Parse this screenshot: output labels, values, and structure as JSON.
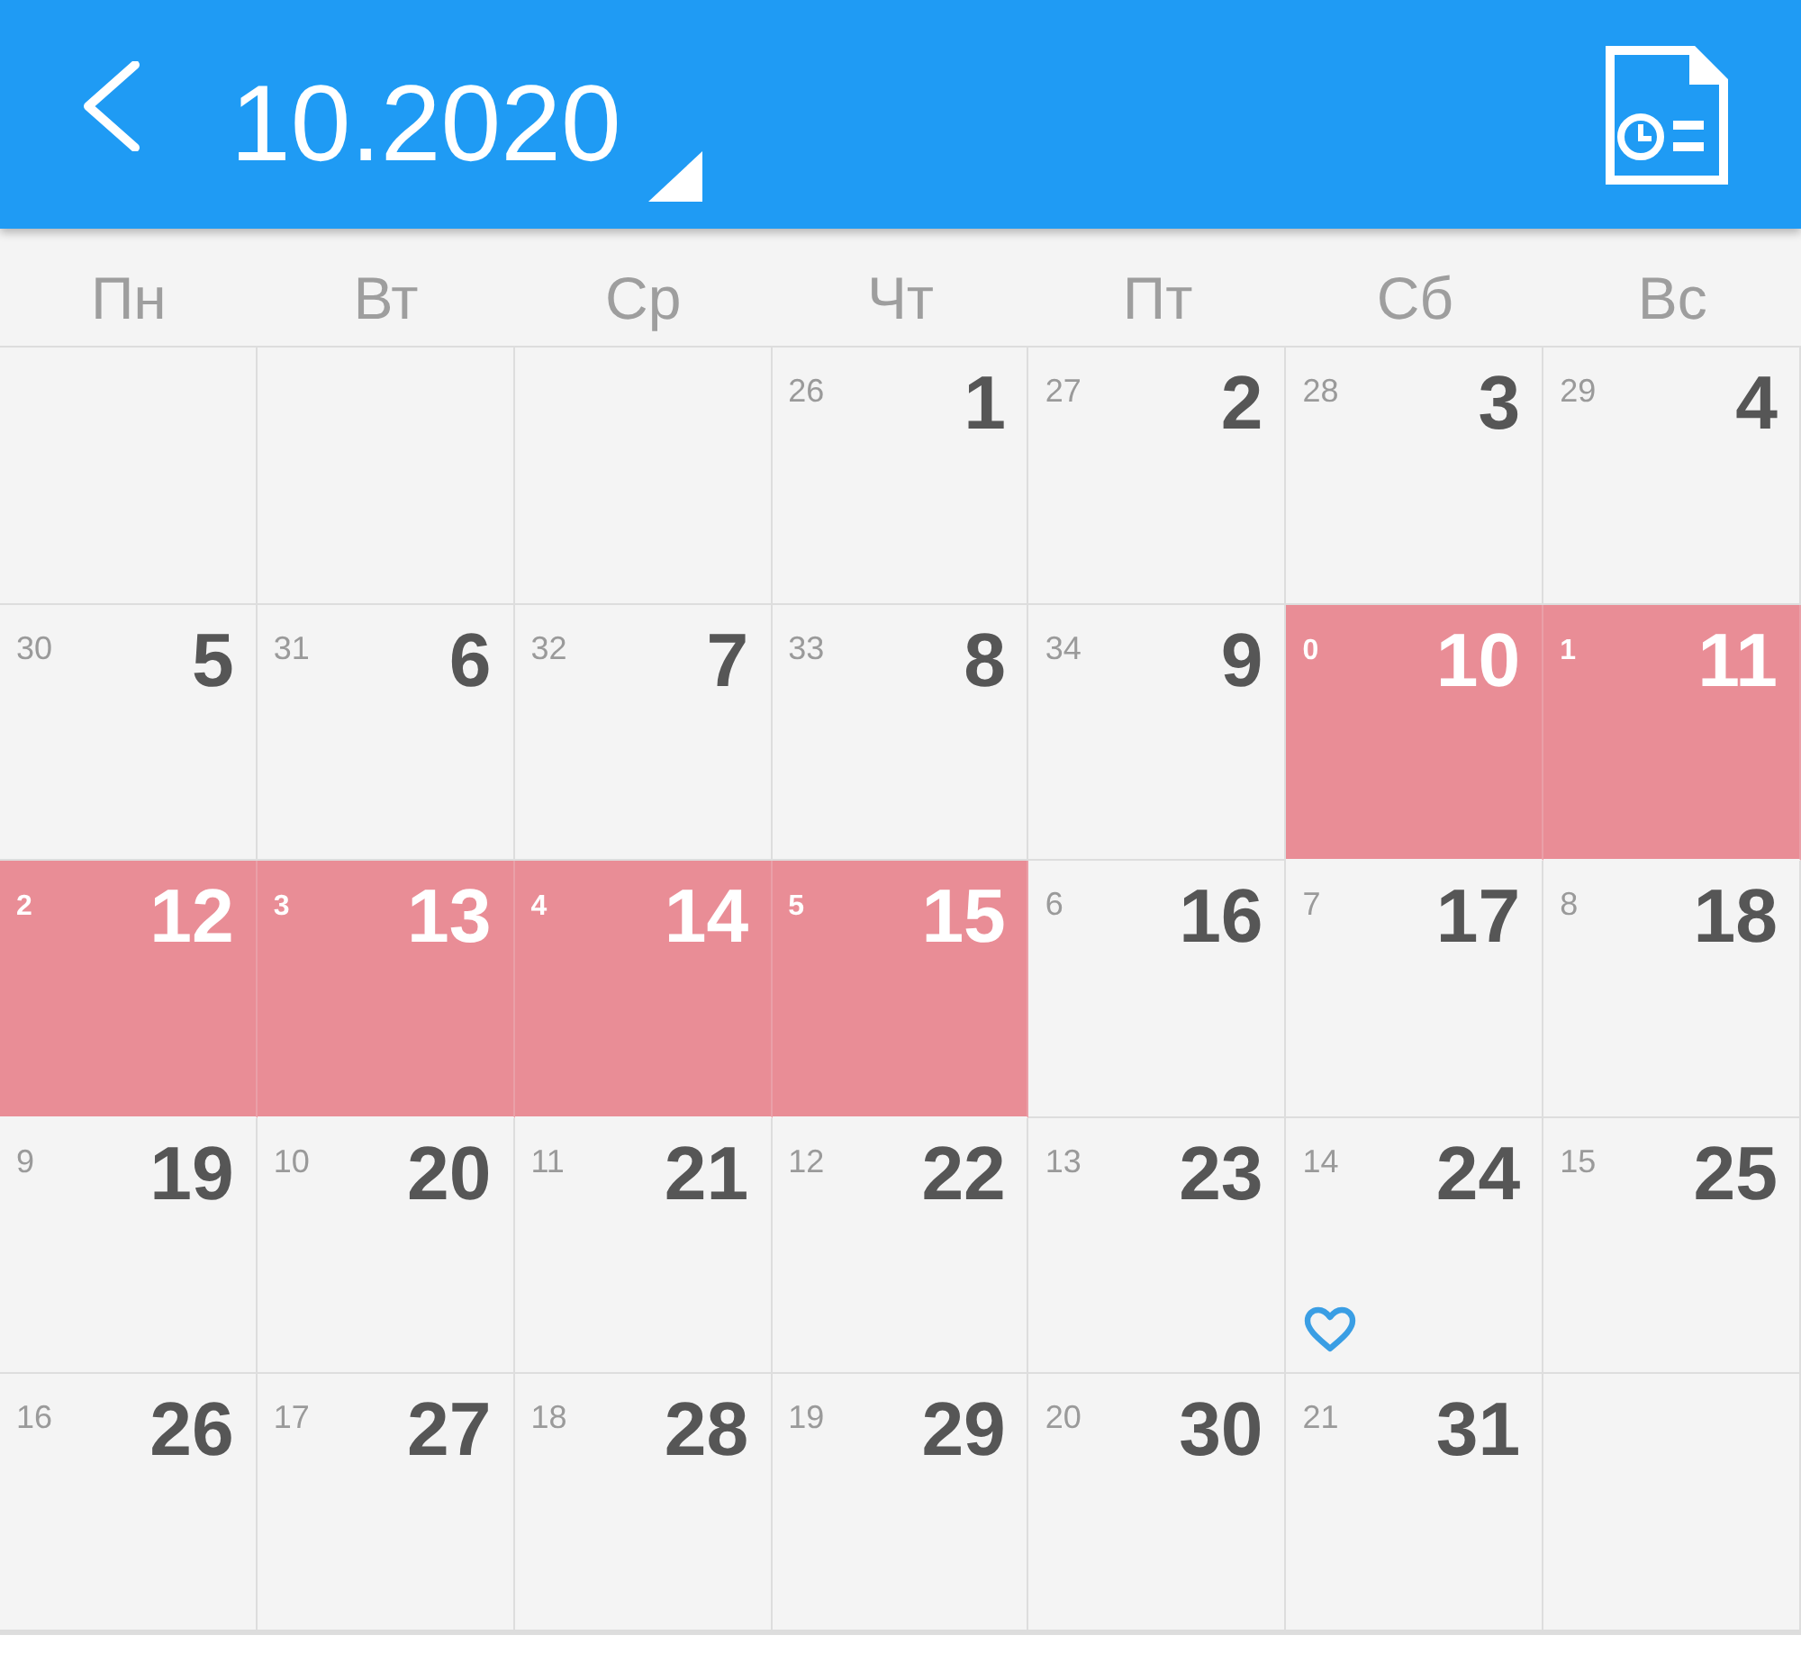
{
  "app_bar": {
    "title": "10.2020"
  },
  "weekdays": [
    "Пн",
    "Вт",
    "Ср",
    "Чт",
    "Пт",
    "Сб",
    "Вс"
  ],
  "weeks": [
    {
      "days": [
        {
          "kind": "empty"
        },
        {
          "kind": "empty"
        },
        {
          "kind": "empty"
        },
        {
          "kind": "day",
          "cycle_day": "26",
          "date": "1",
          "period": false,
          "heart": false
        },
        {
          "kind": "day",
          "cycle_day": "27",
          "date": "2",
          "period": false,
          "heart": false
        },
        {
          "kind": "day",
          "cycle_day": "28",
          "date": "3",
          "period": false,
          "heart": false
        },
        {
          "kind": "day",
          "cycle_day": "29",
          "date": "4",
          "period": false,
          "heart": false
        }
      ]
    },
    {
      "days": [
        {
          "kind": "day",
          "cycle_day": "30",
          "date": "5",
          "period": false,
          "heart": false
        },
        {
          "kind": "day",
          "cycle_day": "31",
          "date": "6",
          "period": false,
          "heart": false
        },
        {
          "kind": "day",
          "cycle_day": "32",
          "date": "7",
          "period": false,
          "heart": false
        },
        {
          "kind": "day",
          "cycle_day": "33",
          "date": "8",
          "period": false,
          "heart": false
        },
        {
          "kind": "day",
          "cycle_day": "34",
          "date": "9",
          "period": false,
          "heart": false
        },
        {
          "kind": "day",
          "cycle_day": "0",
          "date": "10",
          "period": true,
          "heart": false
        },
        {
          "kind": "day",
          "cycle_day": "1",
          "date": "11",
          "period": true,
          "heart": false
        }
      ]
    },
    {
      "days": [
        {
          "kind": "day",
          "cycle_day": "2",
          "date": "12",
          "period": true,
          "heart": false
        },
        {
          "kind": "day",
          "cycle_day": "3",
          "date": "13",
          "period": true,
          "heart": false
        },
        {
          "kind": "day",
          "cycle_day": "4",
          "date": "14",
          "period": true,
          "heart": false
        },
        {
          "kind": "day",
          "cycle_day": "5",
          "date": "15",
          "period": true,
          "heart": false
        },
        {
          "kind": "day",
          "cycle_day": "6",
          "date": "16",
          "period": false,
          "heart": false
        },
        {
          "kind": "day",
          "cycle_day": "7",
          "date": "17",
          "period": false,
          "heart": false
        },
        {
          "kind": "day",
          "cycle_day": "8",
          "date": "18",
          "period": false,
          "heart": false
        }
      ]
    },
    {
      "days": [
        {
          "kind": "day",
          "cycle_day": "9",
          "date": "19",
          "period": false,
          "heart": false
        },
        {
          "kind": "day",
          "cycle_day": "10",
          "date": "20",
          "period": false,
          "heart": false
        },
        {
          "kind": "day",
          "cycle_day": "11",
          "date": "21",
          "period": false,
          "heart": false
        },
        {
          "kind": "day",
          "cycle_day": "12",
          "date": "22",
          "period": false,
          "heart": false
        },
        {
          "kind": "day",
          "cycle_day": "13",
          "date": "23",
          "period": false,
          "heart": false
        },
        {
          "kind": "day",
          "cycle_day": "14",
          "date": "24",
          "period": false,
          "heart": true
        },
        {
          "kind": "day",
          "cycle_day": "15",
          "date": "25",
          "period": false,
          "heart": false
        }
      ]
    },
    {
      "days": [
        {
          "kind": "day",
          "cycle_day": "16",
          "date": "26",
          "period": false,
          "heart": false
        },
        {
          "kind": "day",
          "cycle_day": "17",
          "date": "27",
          "period": false,
          "heart": false
        },
        {
          "kind": "day",
          "cycle_day": "18",
          "date": "28",
          "period": false,
          "heart": false
        },
        {
          "kind": "day",
          "cycle_day": "19",
          "date": "29",
          "period": false,
          "heart": false
        },
        {
          "kind": "day",
          "cycle_day": "20",
          "date": "30",
          "period": false,
          "heart": false
        },
        {
          "kind": "day",
          "cycle_day": "21",
          "date": "31",
          "period": false,
          "heart": false
        },
        {
          "kind": "empty"
        }
      ]
    }
  ]
}
